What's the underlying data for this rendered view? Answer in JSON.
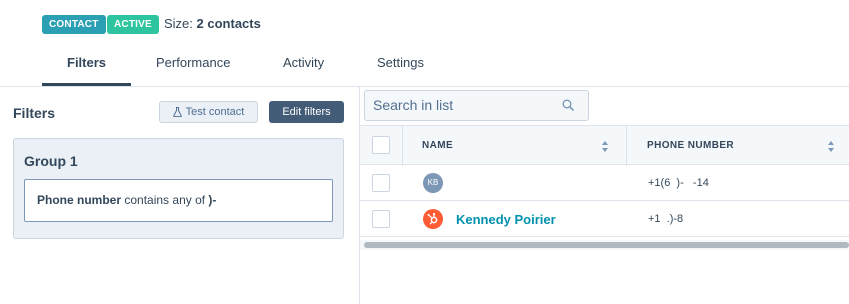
{
  "header": {
    "badges": [
      "CONTACT",
      "ACTIVE"
    ],
    "size_label": "Size:",
    "size_value": "2 contacts"
  },
  "tabs": [
    "Filters",
    "Performance",
    "Activity",
    "Settings"
  ],
  "left": {
    "title": "Filters",
    "test_contact_label": "Test contact",
    "edit_filters_label": "Edit filters",
    "group_title": "Group 1",
    "filter": {
      "property": "Phone number",
      "operator": "contains any of",
      "value": ")-"
    }
  },
  "right": {
    "search_placeholder": "Search in list",
    "columns": [
      "NAME",
      "PHONE NUMBER"
    ],
    "rows": [
      {
        "avatar": "KB",
        "name": "",
        "phone": "+1(6  )-   -14   "
      },
      {
        "avatar": "",
        "name": "Kennedy Poirier",
        "phone": "+1  .)-8          "
      }
    ]
  },
  "colors": {
    "contact_badge": "#2b9fb3",
    "active_badge": "#2ec4a0",
    "link": "#0091ae",
    "primary_button": "#425b76",
    "hubspot_orange": "#ff5c35"
  }
}
